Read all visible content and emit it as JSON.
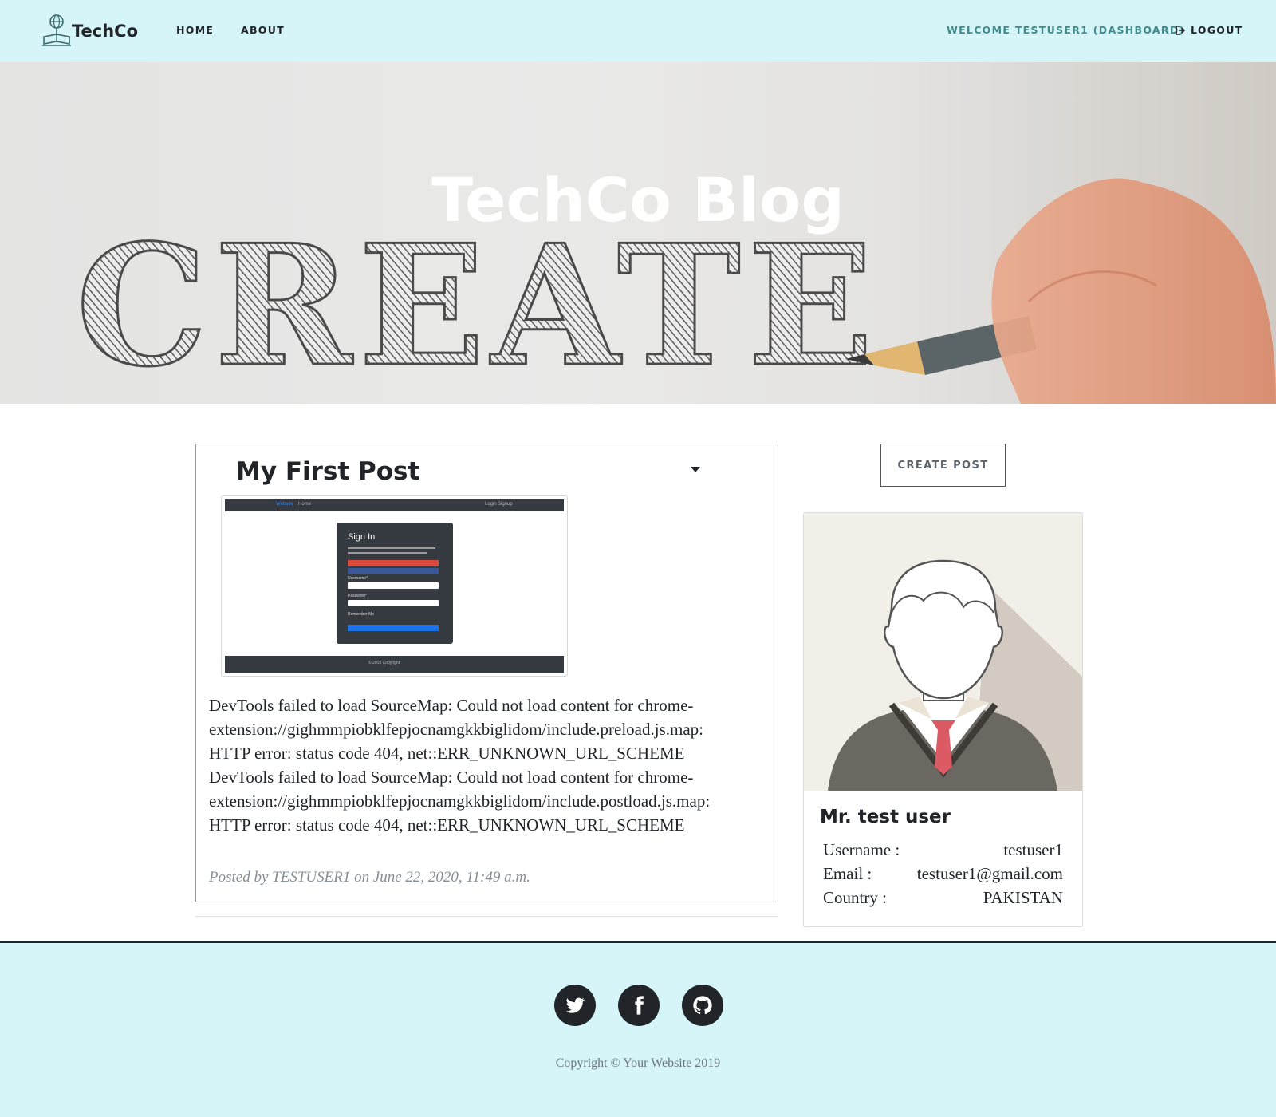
{
  "navbar": {
    "brand": "TechCo",
    "links": {
      "home": "HOME",
      "about": "ABOUT"
    },
    "welcome": "WELCOME TESTUSER1 (DASHBOARD)",
    "logout": "LOGOUT"
  },
  "hero": {
    "title": "TechCo Blog",
    "background_word": "CREATE"
  },
  "post": {
    "title": "My First Post",
    "body_lines": [
      "DevTools failed to load SourceMap: Could not load content for chrome-",
      "extension://gighmmpiobklfepjocnamgkkbiglidom/include.preload.js.map:",
      "HTTP error: status code 404, net::ERR_UNKNOWN_URL_SCHEME",
      "DevTools failed to load SourceMap: Could not load content for chrome-",
      "extension://gighmmpiobklfepjocnamgkkbiglidom/include.postload.js.map:",
      "HTTP error: status code 404, net::ERR_UNKNOWN_URL_SCHEME"
    ],
    "meta": "Posted by TESTUSER1 on June 22, 2020, 11:49 a.m.",
    "image": {
      "nav_brand": "Website",
      "nav_home": "Home",
      "nav_login": "Login",
      "nav_signup": "Signup",
      "modal_title": "Sign In",
      "username_label": "Username*",
      "password_label": "Password*",
      "remember": "Remember Me",
      "footer": "© 2019 Copyright"
    }
  },
  "sidebar": {
    "create_button": "CREATE POST",
    "profile": {
      "name": "Mr. test user",
      "username_key": "Username :",
      "username_val": "testuser1",
      "email_key": "Email :",
      "email_val": "testuser1@gmail.com",
      "country_key": "Country :",
      "country_val": "PAKISTAN"
    }
  },
  "footer": {
    "copyright": "Copyright © Your Website 2019",
    "icons": [
      "twitter-icon",
      "facebook-icon",
      "github-icon"
    ]
  },
  "colors": {
    "navbar_bg": "#d6f5f9",
    "footer_bg": "#d6f5f9",
    "welcome_link": "#3f8b8b",
    "text_dark": "#212529",
    "meta_grey": "#868e96"
  }
}
